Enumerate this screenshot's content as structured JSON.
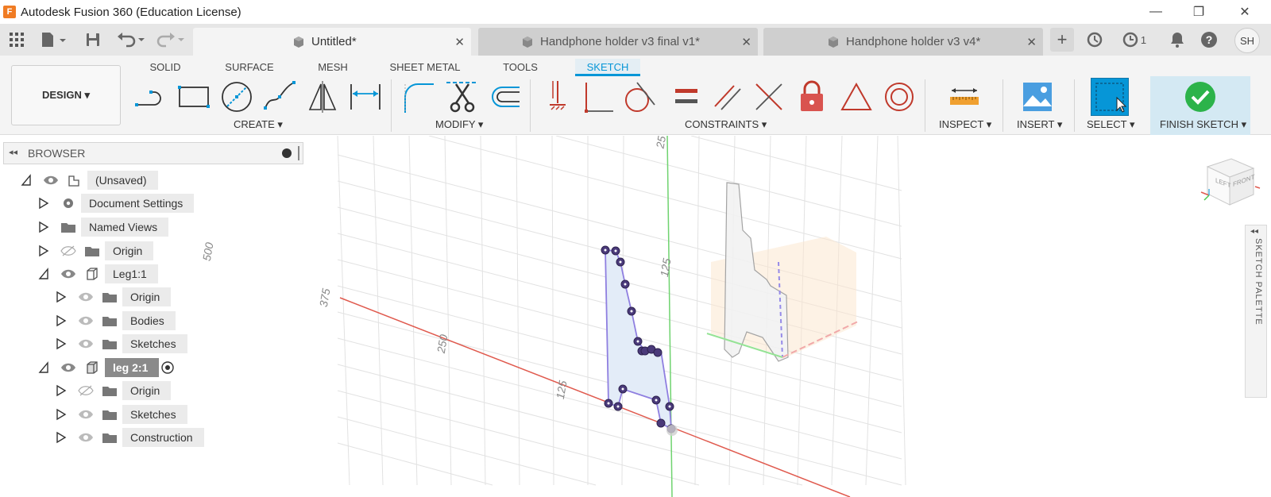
{
  "window": {
    "title": "Autodesk Fusion 360 (Education License)",
    "minimize": "—",
    "restore": "❐",
    "close": "✕"
  },
  "tabs": [
    {
      "label": "Untitled*",
      "active": true
    },
    {
      "label": "Handphone holder v3 final v1*",
      "active": false
    },
    {
      "label": "Handphone holder v3 v4*",
      "active": false
    }
  ],
  "quick_access": {
    "job_count": "1",
    "user_initials": "SH"
  },
  "ribbon": {
    "workspace": "DESIGN ▾",
    "tabs": [
      "SOLID",
      "SURFACE",
      "MESH",
      "SHEET METAL",
      "TOOLS",
      "SKETCH"
    ],
    "active_tab": "SKETCH",
    "groups": {
      "create": "CREATE ▾",
      "modify": "MODIFY ▾",
      "constraints": "CONSTRAINTS ▾",
      "inspect": "INSPECT ▾",
      "insert": "INSERT ▾",
      "select": "SELECT ▾",
      "finish": "FINISH SKETCH ▾"
    }
  },
  "browser": {
    "title": "BROWSER",
    "items": [
      {
        "label": "(Unsaved)"
      },
      {
        "label": "Document Settings"
      },
      {
        "label": "Named Views"
      },
      {
        "label": "Origin"
      },
      {
        "label": "Leg1:1"
      },
      {
        "label": "Origin"
      },
      {
        "label": "Bodies"
      },
      {
        "label": "Sketches"
      },
      {
        "label": "leg 2:1"
      },
      {
        "label": "Origin"
      },
      {
        "label": "Sketches"
      },
      {
        "label": "Construction"
      }
    ]
  },
  "viewport": {
    "ruler_labels": [
      "500",
      "375",
      "250",
      "125",
      "125",
      "25"
    ]
  },
  "view_cube": {
    "left": "LEFT",
    "front": "FRONT"
  },
  "sketch_palette": {
    "title": "SKETCH PALETTE"
  },
  "colors": {
    "accent": "#0696d7",
    "finish_green": "#2cb34a",
    "x_axis": "#e05a4e",
    "y_axis": "#4cc94c",
    "sketch": "#7a6ad8"
  }
}
